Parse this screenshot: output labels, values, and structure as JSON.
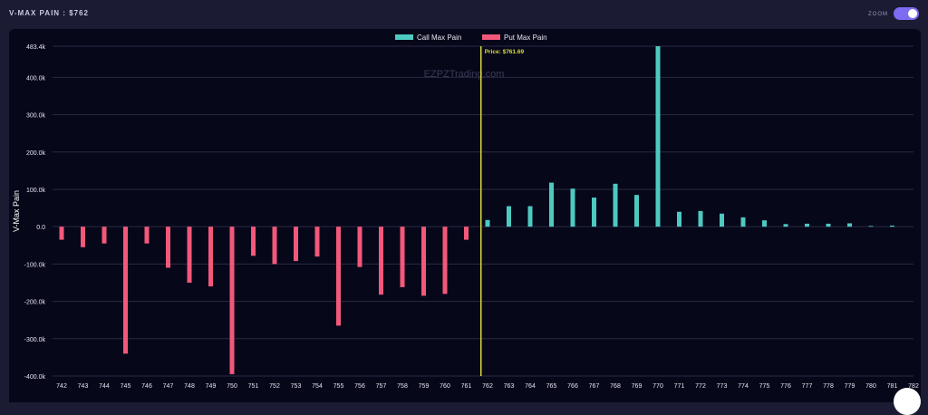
{
  "header": {
    "title": "V-MAX PAIN : $762"
  },
  "zoom": {
    "label": "ZOOM",
    "enabled": true,
    "accent": "#7b6cf0"
  },
  "chart_data": {
    "type": "bar",
    "watermark": "EZPZTrading.com",
    "ylabel": "V-Max Pain",
    "xlabel": "",
    "ylim": [
      -400000,
      483400
    ],
    "yticks": [
      {
        "value": 483400,
        "label": "483.4k"
      },
      {
        "value": 400000,
        "label": "400.0k"
      },
      {
        "value": 300000,
        "label": "300.0k"
      },
      {
        "value": 200000,
        "label": "200.0k"
      },
      {
        "value": 100000,
        "label": "100.0k"
      },
      {
        "value": 0,
        "label": "0.0"
      },
      {
        "value": -100000,
        "label": "-100.0k"
      },
      {
        "value": -200000,
        "label": "-200.0k"
      },
      {
        "value": -300000,
        "label": "-300.0k"
      },
      {
        "value": -400000,
        "label": "-400.0k"
      }
    ],
    "categories": [
      "742",
      "743",
      "744",
      "745",
      "746",
      "747",
      "748",
      "749",
      "750",
      "751",
      "752",
      "753",
      "754",
      "755",
      "756",
      "757",
      "758",
      "759",
      "760",
      "761",
      "762",
      "763",
      "764",
      "765",
      "766",
      "767",
      "768",
      "769",
      "770",
      "771",
      "772",
      "773",
      "774",
      "775",
      "776",
      "777",
      "778",
      "779",
      "780",
      "781",
      "782"
    ],
    "series": [
      {
        "name": "Call Max Pain",
        "color": "#4ec9c0",
        "values": [
          null,
          null,
          null,
          null,
          null,
          null,
          null,
          null,
          null,
          null,
          null,
          null,
          null,
          null,
          null,
          null,
          null,
          null,
          null,
          null,
          18000,
          55000,
          55000,
          118000,
          102000,
          78000,
          115000,
          85000,
          483400,
          40000,
          42000,
          35000,
          25000,
          17000,
          7000,
          8000,
          8000,
          9000,
          2000,
          3000,
          null
        ]
      },
      {
        "name": "Put Max Pain",
        "color": "#f2587a",
        "values": [
          -35000,
          -55000,
          -45000,
          -340000,
          -45000,
          -110000,
          -150000,
          -160000,
          -395000,
          -78000,
          -100000,
          -92000,
          -80000,
          -265000,
          -108000,
          -182000,
          -162000,
          -185000,
          -180000,
          -35000,
          null,
          null,
          null,
          null,
          null,
          null,
          null,
          null,
          null,
          null,
          null,
          null,
          null,
          null,
          null,
          null,
          null,
          null,
          null,
          null,
          null
        ]
      }
    ],
    "price_line": {
      "value": 761.69,
      "label": "Price: $761.69",
      "color": "#d8dc3c"
    },
    "legend": "top-center",
    "grid": true
  }
}
